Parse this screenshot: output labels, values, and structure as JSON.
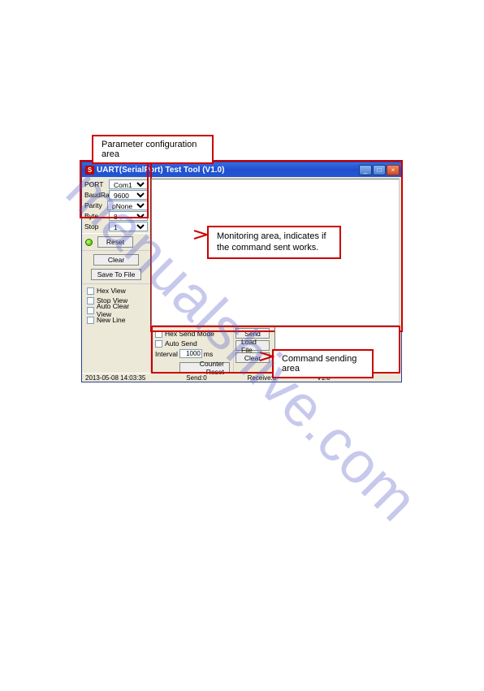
{
  "watermark": "manualshive.com",
  "callouts": {
    "param": "Parameter configuration area",
    "monitor": "Monitoring area, indicates if the command sent works.",
    "command": "Command sending area"
  },
  "window": {
    "title": "UART(SerialPort) Test Tool (V1.0)",
    "icon": "S"
  },
  "params": {
    "port_label": "PORT",
    "port_value": "Com1",
    "baud_label": "BaudRa",
    "baud_value": "9600",
    "parity_label": "Parity",
    "parity_value": "pNone",
    "byte_label": "Byte",
    "byte_value": "8",
    "stop_label": "Stop",
    "stop_value": "1"
  },
  "buttons": {
    "reset": "Reset",
    "clear": "Clear",
    "save_to_file": "Save To File",
    "send": "Send",
    "load_file": "Load File",
    "clear2": "Clear",
    "counter_reset": "Counter Reset"
  },
  "checks": {
    "hex_view": "Hex View",
    "stop_view": "Stop View",
    "auto_clear": "Auto Clear View",
    "new_line": "New Line",
    "hex_send": "Hex Send Mode",
    "auto_send": "Auto Send"
  },
  "interval": {
    "label": "Interval",
    "value": "1000",
    "unit": "ms"
  },
  "status": {
    "timestamp": "2013-05-08 14:03:35",
    "send": "Send:0",
    "receive": "Receive:0",
    "version": "V1.0"
  }
}
